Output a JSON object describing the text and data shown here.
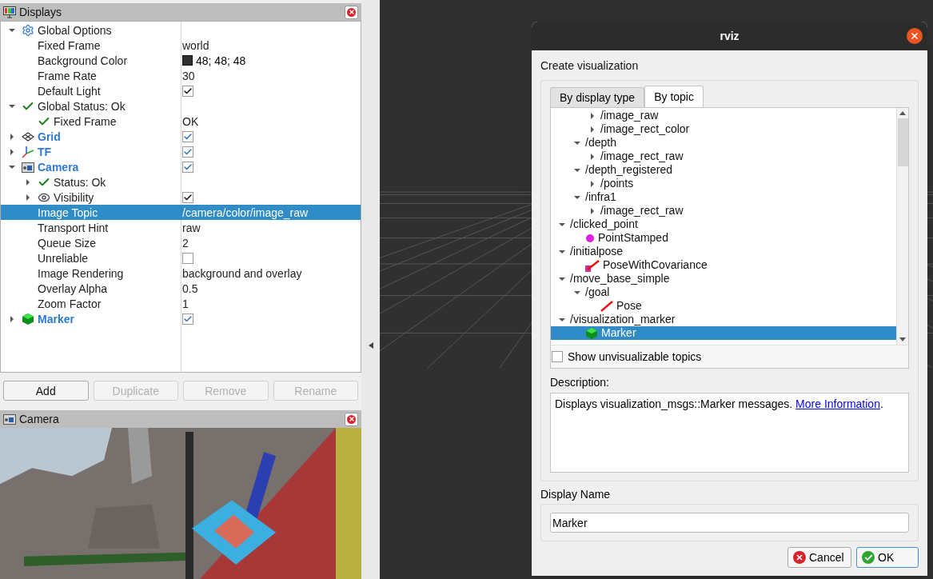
{
  "displays_panel": {
    "title": "Displays",
    "tree": [
      {
        "label": "Global Options",
        "kind": "options",
        "expanded": true,
        "selected": false,
        "children": [
          {
            "label": "Fixed Frame",
            "kind": "property",
            "selected": false,
            "value": {
              "kind": "text",
              "text": "world"
            }
          },
          {
            "label": "Background Color",
            "kind": "property",
            "selected": false,
            "value": {
              "kind": "color",
              "color": "#303030",
              "text": "48; 48; 48"
            }
          },
          {
            "label": "Frame Rate",
            "kind": "property",
            "selected": false,
            "value": {
              "kind": "text",
              "text": "30"
            }
          },
          {
            "label": "Default Light",
            "kind": "property",
            "selected": false,
            "value": {
              "kind": "checkbox",
              "checked": true
            }
          }
        ]
      },
      {
        "label": "Global Status: Ok",
        "kind": "status",
        "expanded": true,
        "selected": false,
        "children": [
          {
            "label": "Fixed Frame",
            "kind": "status",
            "selected": false,
            "value": {
              "kind": "text",
              "text": "OK"
            }
          }
        ]
      },
      {
        "label": "Grid",
        "kind": "grid",
        "expanded": false,
        "selected": false,
        "value": {
          "kind": "checkbox",
          "checked": true
        }
      },
      {
        "label": "TF",
        "kind": "tf",
        "expanded": false,
        "selected": false,
        "value": {
          "kind": "checkbox",
          "checked": true
        }
      },
      {
        "label": "Camera",
        "kind": "camera",
        "expanded": true,
        "selected": false,
        "value": {
          "kind": "checkbox",
          "checked": true
        },
        "children": [
          {
            "label": "Status: Ok",
            "kind": "status",
            "expanded": false,
            "selected": false
          },
          {
            "label": "Visibility",
            "kind": "visibility",
            "expanded": false,
            "selected": false,
            "value": {
              "kind": "checkbox",
              "checked": true
            }
          },
          {
            "label": "Image Topic",
            "kind": "property",
            "selected": true,
            "value": {
              "kind": "text",
              "text": "/camera/color/image_raw"
            }
          },
          {
            "label": "Transport Hint",
            "kind": "property",
            "selected": false,
            "value": {
              "kind": "text",
              "text": "raw"
            }
          },
          {
            "label": "Queue Size",
            "kind": "property",
            "selected": false,
            "value": {
              "kind": "text",
              "text": "2"
            }
          },
          {
            "label": "Unreliable",
            "kind": "property",
            "selected": false,
            "value": {
              "kind": "checkbox",
              "checked": false
            }
          },
          {
            "label": "Image Rendering",
            "kind": "property",
            "selected": false,
            "value": {
              "kind": "text",
              "text": "background and overlay"
            }
          },
          {
            "label": "Overlay Alpha",
            "kind": "property",
            "selected": false,
            "value": {
              "kind": "text",
              "text": "0.5"
            }
          },
          {
            "label": "Zoom Factor",
            "kind": "property",
            "selected": false,
            "value": {
              "kind": "text",
              "text": "1"
            }
          }
        ]
      },
      {
        "label": "Marker",
        "kind": "marker",
        "expanded": false,
        "selected": false,
        "value": {
          "kind": "checkbox",
          "checked": true
        }
      }
    ],
    "buttons": [
      {
        "label": "Add",
        "disabled": false
      },
      {
        "label": "Duplicate",
        "disabled": true
      },
      {
        "label": "Remove",
        "disabled": true
      },
      {
        "label": "Rename",
        "disabled": true
      }
    ]
  },
  "camera_panel": {
    "title": "Camera"
  },
  "dialog": {
    "title": "rviz",
    "heading": "Create visualization",
    "tabs": [
      {
        "label": "By display type",
        "selected": false
      },
      {
        "label": "By topic",
        "selected": true
      }
    ],
    "topics": [
      {
        "children": [
          {
            "children": [
              {
                "label": "/image_raw",
                "kind": "topic",
                "expanded": false,
                "selected": false
              },
              {
                "label": "/image_rect_color",
                "kind": "topic",
                "expanded": false,
                "selected": false
              }
            ]
          },
          {
            "label": "/depth",
            "kind": "topic",
            "expanded": true,
            "selected": false,
            "children": [
              {
                "label": "/image_rect_raw",
                "kind": "topic",
                "expanded": false,
                "selected": false
              }
            ]
          },
          {
            "label": "/depth_registered",
            "kind": "topic",
            "expanded": true,
            "selected": false,
            "children": [
              {
                "label": "/points",
                "kind": "topic",
                "expanded": false,
                "selected": false
              }
            ]
          },
          {
            "label": "/infra1",
            "kind": "topic",
            "expanded": true,
            "selected": false,
            "children": [
              {
                "label": "/image_rect_raw",
                "kind": "topic",
                "expanded": false,
                "selected": false
              }
            ]
          }
        ]
      },
      {
        "label": "/clicked_point",
        "kind": "topic",
        "expanded": true,
        "selected": false,
        "children": [
          {
            "label": "PointStamped",
            "kind": "point",
            "selected": false
          }
        ]
      },
      {
        "label": "/initialpose",
        "kind": "topic",
        "expanded": true,
        "selected": false,
        "children": [
          {
            "label": "PoseWithCovariance",
            "kind": "pose_covariance",
            "selected": false
          }
        ]
      },
      {
        "label": "/move_base_simple",
        "kind": "topic",
        "expanded": true,
        "selected": false,
        "children": [
          {
            "label": "/goal",
            "kind": "topic",
            "expanded": true,
            "selected": false,
            "children": [
              {
                "label": "Pose",
                "kind": "pose",
                "selected": false
              }
            ]
          }
        ]
      },
      {
        "label": "/visualization_marker",
        "kind": "topic",
        "expanded": true,
        "selected": false,
        "children": [
          {
            "label": "Marker",
            "kind": "marker",
            "selected": true
          }
        ]
      }
    ],
    "show_unvisualizable": {
      "label": "Show unvisualizable topics",
      "checked": false
    },
    "description_label": "Description:",
    "description": {
      "text": "Displays visualization_msgs::Marker messages.",
      "link": "More Information",
      "after": "."
    },
    "display_name_label": "Display Name",
    "display_name": {
      "value": "Marker"
    },
    "buttons": [
      {
        "label": "Cancel",
        "kind": "cancel"
      },
      {
        "label": "OK",
        "kind": "ok"
      }
    ]
  }
}
